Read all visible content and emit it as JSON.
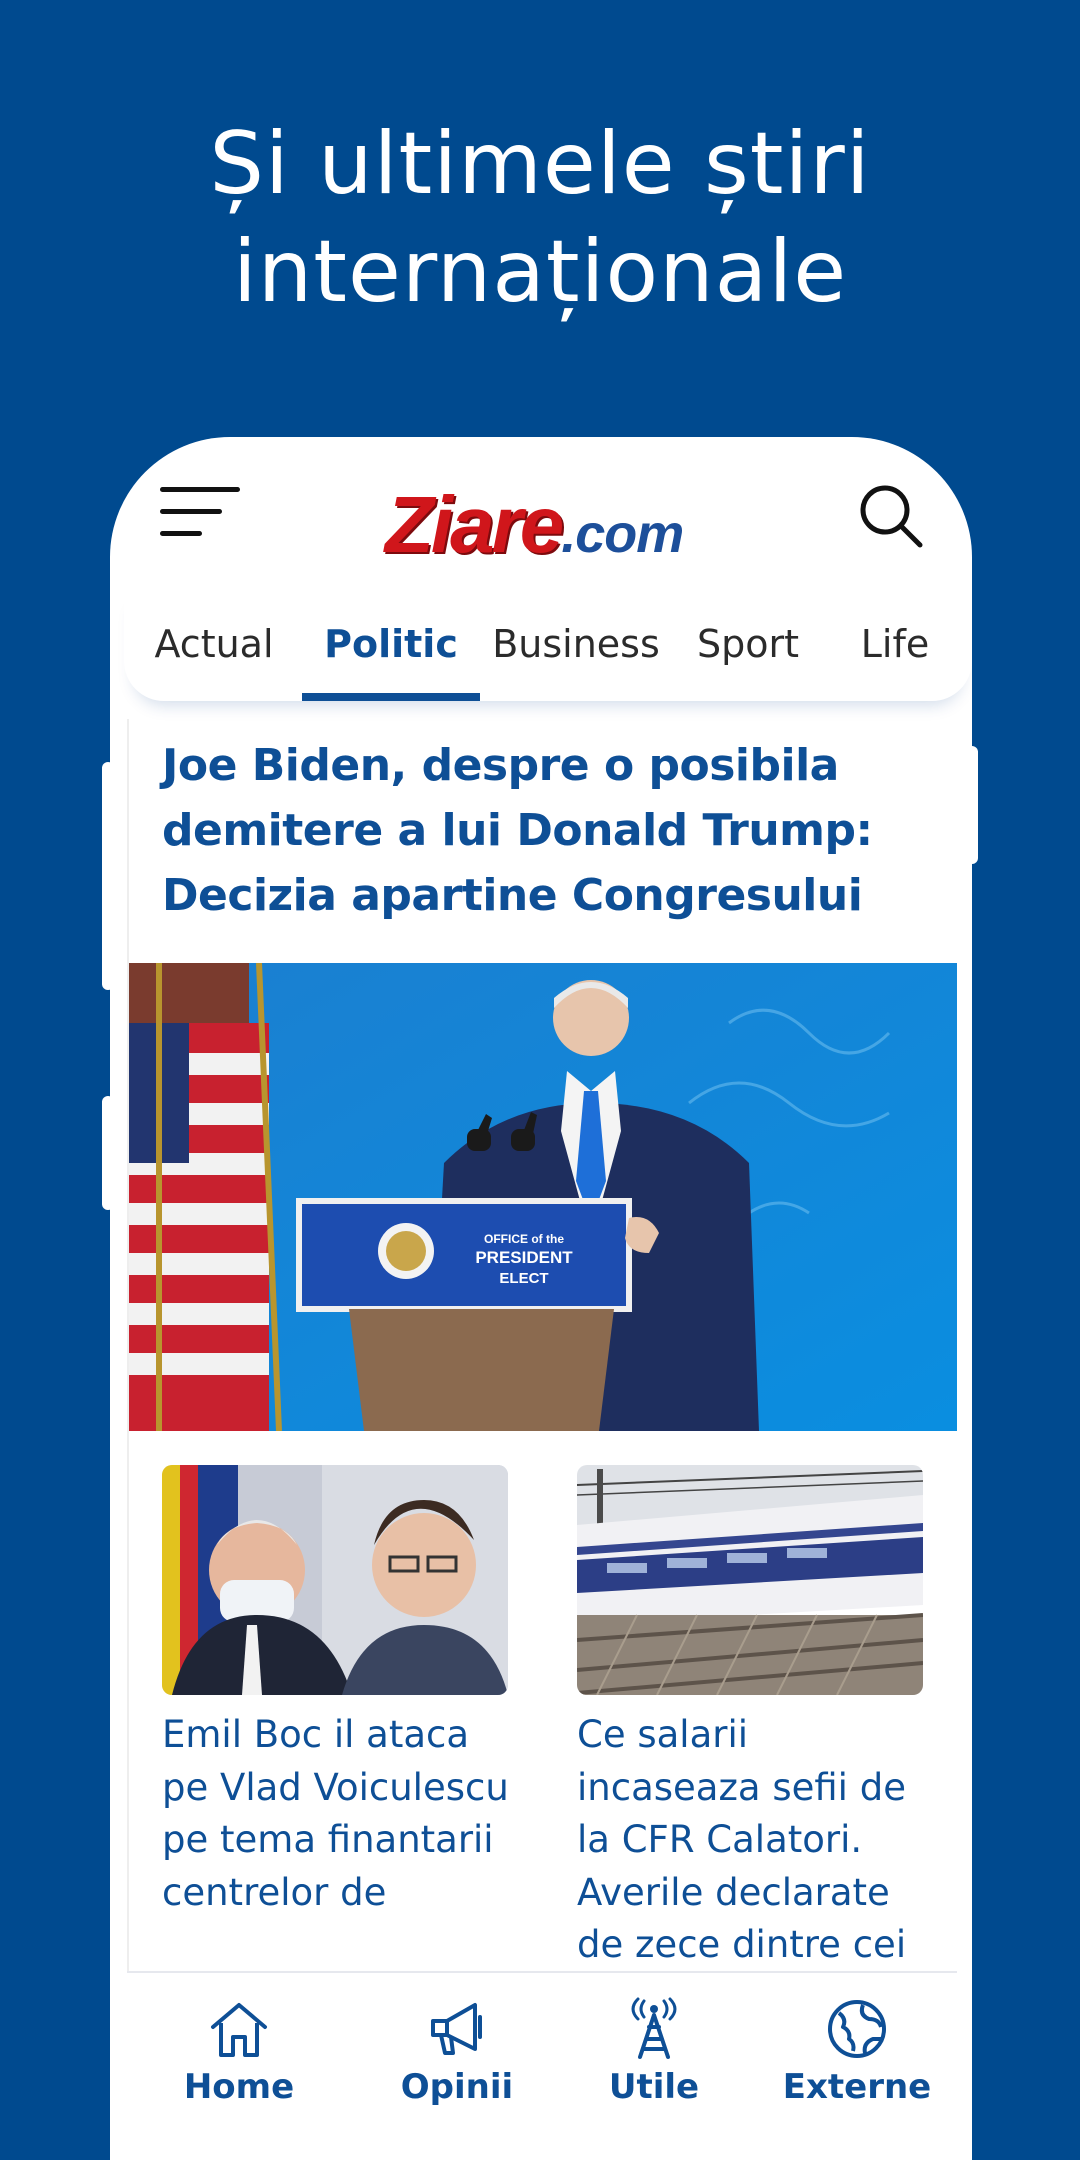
{
  "promo": {
    "line1": "Și ultimele știri",
    "line2": "internaționale"
  },
  "header": {
    "logo_brand": "Ziare",
    "logo_tld": ".com",
    "menu_icon": "menu-icon",
    "search_icon": "search-icon"
  },
  "tabs": [
    {
      "label": "Actual",
      "active": false
    },
    {
      "label": "Politic",
      "active": true
    },
    {
      "label": "Business",
      "active": false
    },
    {
      "label": "Sport",
      "active": false
    },
    {
      "label": "Life",
      "active": false
    }
  ],
  "main_article": {
    "title": "Joe Biden, despre o posibila demitere a lui Donald Trump: Decizia apartine Congresului",
    "podium_text_1": "OFFICE of the",
    "podium_text_2": "PRESIDENT",
    "podium_text_3": "ELECT"
  },
  "cards": [
    {
      "title": "Emil Boc il ataca pe Vlad Voiculescu pe tema finantarii centrelor de"
    },
    {
      "title": "Ce salarii incaseaza sefii de la CFR Calatori. Averile declarate de zece dintre cei"
    }
  ],
  "bottom_nav": [
    {
      "label": "Home",
      "icon": "home-icon"
    },
    {
      "label": "Opinii",
      "icon": "megaphone-icon"
    },
    {
      "label": "Utile",
      "icon": "antenna-icon"
    },
    {
      "label": "Externe",
      "icon": "globe-icon"
    }
  ],
  "colors": {
    "background": "#004a8f",
    "accent": "#0e4f96",
    "logo_red": "#d0161b"
  }
}
